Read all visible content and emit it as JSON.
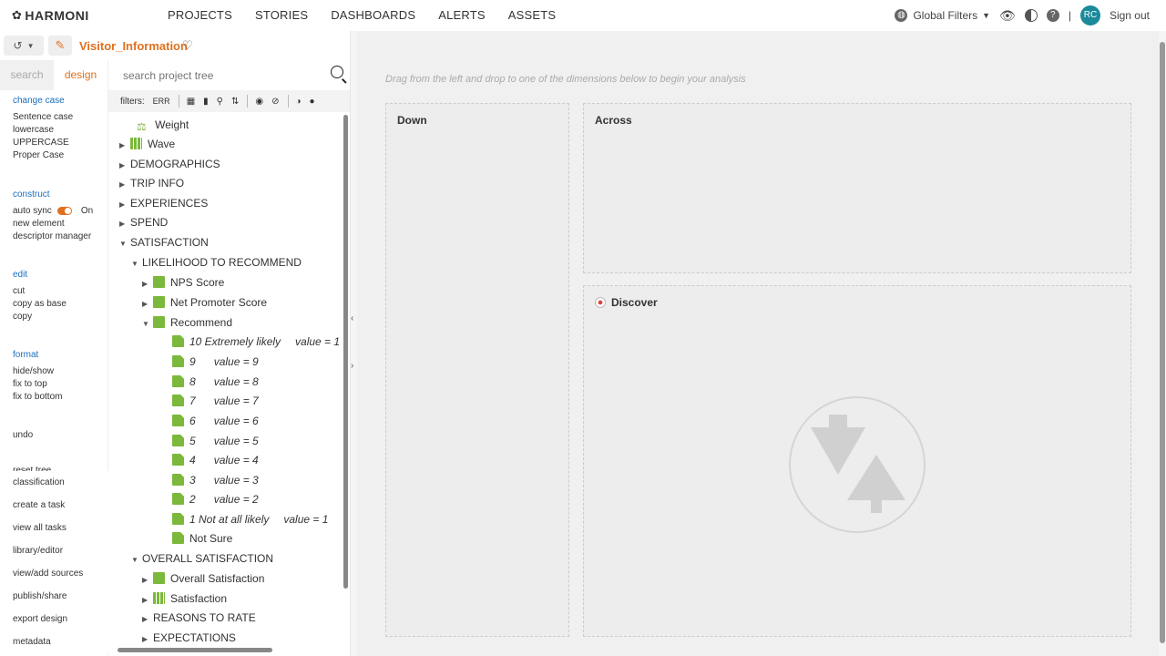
{
  "topbar": {
    "logo_text": "HARMONI",
    "nav": [
      "PROJECTS",
      "STORIES",
      "DASHBOARDS",
      "ALERTS",
      "ASSETS"
    ],
    "global_filters": "Global Filters",
    "avatar": "RC",
    "separator": "|",
    "signout": "Sign out"
  },
  "titlebar": {
    "project_name": "Visitor_Information"
  },
  "left": {
    "tabs": [
      "search",
      "design"
    ],
    "change_case": {
      "head": "change case",
      "items": [
        "Sentence case",
        "lowercase",
        "UPPERCASE",
        "Proper Case"
      ]
    },
    "construct": {
      "head": "construct",
      "auto_sync": "auto sync",
      "auto_sync_state": "On",
      "items": [
        "new element",
        "descriptor manager"
      ]
    },
    "edit": {
      "head": "edit",
      "items": [
        "cut",
        "copy as base",
        "copy"
      ]
    },
    "format": {
      "head": "format",
      "items": [
        "hide/show",
        "fix to top",
        "fix to bottom"
      ]
    },
    "undo": "undo",
    "reset_tree": "reset tree",
    "bottom": [
      "classification",
      "create a task",
      "view all tasks",
      "library/editor",
      "view/add sources",
      "publish/share",
      "export design",
      "metadata"
    ]
  },
  "tree": {
    "search_placeholder": "search project tree",
    "filters_label": "filters:",
    "filters_err": "ERR",
    "nodes": [
      {
        "label": "Weight"
      },
      {
        "label": "Wave"
      },
      {
        "label": "DEMOGRAPHICS"
      },
      {
        "label": "TRIP INFO"
      },
      {
        "label": "EXPERIENCES"
      },
      {
        "label": "SPEND"
      },
      {
        "label": "SATISFACTION"
      },
      {
        "label": "LIKELIHOOD TO RECOMMEND"
      },
      {
        "label": "NPS Score"
      },
      {
        "label": "Net Promoter Score"
      },
      {
        "label": "Recommend"
      },
      {
        "label": "10 Extremely likely",
        "value": "value = 1"
      },
      {
        "label": "9",
        "value": "value = 9"
      },
      {
        "label": "8",
        "value": "value = 8"
      },
      {
        "label": "7",
        "value": "value = 7"
      },
      {
        "label": "6",
        "value": "value = 6"
      },
      {
        "label": "5",
        "value": "value = 5"
      },
      {
        "label": "4",
        "value": "value = 4"
      },
      {
        "label": "3",
        "value": "value = 3"
      },
      {
        "label": "2",
        "value": "value = 2"
      },
      {
        "label": "1 Not at all likely",
        "value": "value = 1"
      },
      {
        "label": "Not Sure"
      },
      {
        "label": "OVERALL SATISFACTION"
      },
      {
        "label": "Overall Satisfaction"
      },
      {
        "label": "Satisfaction"
      },
      {
        "label": "REASONS TO RATE"
      },
      {
        "label": "EXPECTATIONS"
      }
    ]
  },
  "main": {
    "hint": "Drag from the left and drop to one of the dimensions below to begin your analysis",
    "down": "Down",
    "across": "Across",
    "discover": "Discover"
  },
  "colors": {
    "accent": "#e07020",
    "link": "#1a6fbf",
    "tree_icon": "#7bb83b",
    "avatar": "#1a8a9b"
  }
}
